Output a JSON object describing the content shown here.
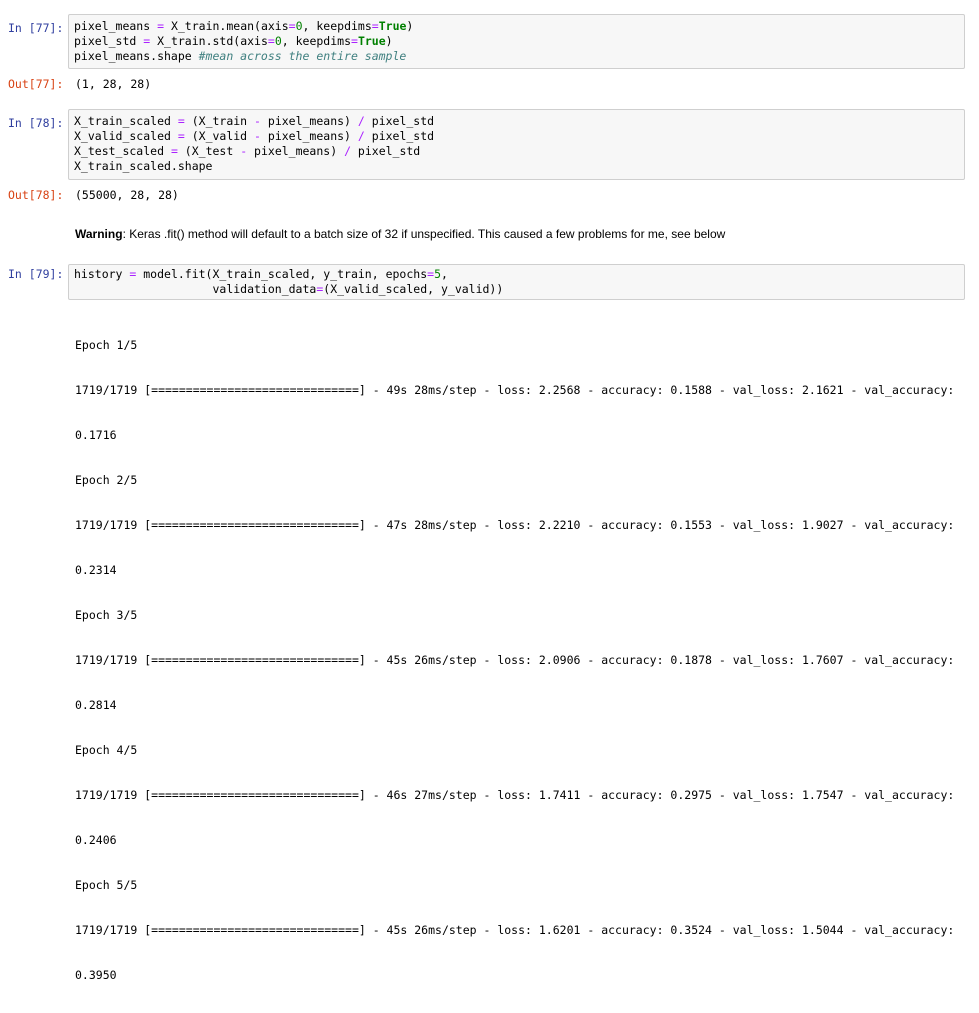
{
  "cells": [
    {
      "in_prompt": "In [77]:",
      "code": [
        [
          "pixel_means ",
          "= ",
          "X_train.mean(axis",
          "=",
          "0",
          ", keepdims",
          "=",
          "True",
          ")"
        ],
        [
          "pixel_std ",
          "= ",
          "X_train.std(axis",
          "=",
          "0",
          ", keepdims",
          "=",
          "True",
          ")"
        ],
        [
          "pixel_means.shape ",
          "#mean across the entire sample"
        ]
      ],
      "out_prompt": "Out[77]:",
      "output": "(1, 28, 28)"
    },
    {
      "in_prompt": "In [78]:",
      "code": [
        [
          "X_train_scaled ",
          "= ",
          "(X_train ",
          "- ",
          "pixel_means) ",
          "/ ",
          "pixel_std"
        ],
        [
          "X_valid_scaled ",
          "= ",
          "(X_valid ",
          "- ",
          "pixel_means) ",
          "/ ",
          "pixel_std"
        ],
        [
          "X_test_scaled ",
          "= ",
          "(X_test ",
          "- ",
          "pixel_means) ",
          "/ ",
          "pixel_std"
        ],
        [
          "X_train_scaled.shape"
        ]
      ],
      "out_prompt": "Out[78]:",
      "output": "(55000, 28, 28)"
    },
    {
      "warning_label": "Warning",
      "warning_text": ": Keras .fit() method will default to a batch size of 32 if unspecified. This caused a few problems for me, see below"
    },
    {
      "in_prompt": "In [79]:",
      "code": [
        [
          "history ",
          "= ",
          "model.fit(X_train_scaled, y_train, epochs",
          "=",
          "5",
          ","
        ],
        [
          "                    validation_data",
          "=",
          "(X_valid_scaled, y_valid))"
        ]
      ],
      "output_lines": [
        "Epoch 1/5",
        "1719/1719 [==============================] - 49s 28ms/step - loss: 2.2568 - accuracy: 0.1588 - val_loss: 2.1621 - val_accuracy:",
        "0.1716",
        "Epoch 2/5",
        "1719/1719 [==============================] - 47s 28ms/step - loss: 2.2210 - accuracy: 0.1553 - val_loss: 1.9027 - val_accuracy:",
        "0.2314",
        "Epoch 3/5",
        "1719/1719 [==============================] - 45s 26ms/step - loss: 2.0906 - accuracy: 0.1878 - val_loss: 1.7607 - val_accuracy:",
        "0.2814",
        "Epoch 4/5",
        "1719/1719 [==============================] - 46s 27ms/step - loss: 1.7411 - accuracy: 0.2975 - val_loss: 1.7547 - val_accuracy:",
        "0.2406",
        "Epoch 5/5",
        "1719/1719 [==============================] - 45s 26ms/step - loss: 1.6201 - accuracy: 0.3524 - val_loss: 1.5044 - val_accuracy:",
        "0.3950"
      ]
    }
  ],
  "colors": {
    "in_prompt": "#303f9f",
    "out_prompt": "#d84315",
    "keyword": "#008000",
    "operator": "#aa22ff",
    "comment": "#408080",
    "input_bg": "#f7f7f7"
  }
}
